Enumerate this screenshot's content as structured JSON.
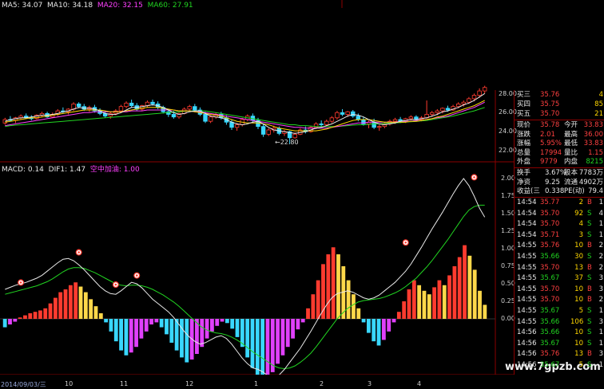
{
  "colors": {
    "ma5": "#e8e8e8",
    "ma10": "#ffd700",
    "ma20": "#ff40ff",
    "ma60": "#21d421",
    "bar_pos_red": "#ff3b2f",
    "bar_pos_yel": "#ffd84a",
    "bar_neg_mag": "#e040fb",
    "bar_neg_cyn": "#39d7ff",
    "border": "#8b0000"
  },
  "header": {
    "ma5": "MA5: 34.07",
    "ma10": "MA10: 34.18",
    "ma20": "MA20: 32.15",
    "ma60": "MA60: 27.91"
  },
  "price_axis": [
    "28.00",
    "26.00",
    "24.00",
    "22.00"
  ],
  "price_annotation": "←22.80",
  "macd_header": {
    "macd": "MACD: 0.14",
    "dif": "DIF1: 1.47",
    "signal": "空中加油: 1.00"
  },
  "macd_axis": [
    "2.00",
    "1.75",
    "1.50",
    "1.25",
    "1.00",
    "0.75",
    "0.50",
    "0.25",
    "0.00"
  ],
  "x_labels": [
    "2014/09/03/三",
    "10",
    "11",
    "12",
    "1",
    "2",
    "3",
    "4"
  ],
  "watermark": "www.7gpzb.com",
  "quotes": [
    {
      "label": "买三",
      "value": "35.76",
      "vol": "4"
    },
    {
      "label": "买四",
      "value": "35.75",
      "vol": "85"
    },
    {
      "label": "买五",
      "value": "35.70",
      "vol": "21"
    }
  ],
  "stats": [
    {
      "l1": "现价",
      "v1": "35.78",
      "l2": "今开",
      "v2": "33.83"
    },
    {
      "l1": "涨跌",
      "v1": "2.01",
      "l2": "最高",
      "v2": "36.00"
    },
    {
      "l1": "涨幅",
      "v1": "5.95%",
      "l2": "最低",
      "v2": "33.83"
    },
    {
      "l1": "总量",
      "v1": "17994",
      "l2": "量比",
      "v2": "1.15"
    },
    {
      "l1": "外盘",
      "v1": "9779",
      "l2": "内盘",
      "v2": "8215"
    }
  ],
  "info": [
    {
      "l1": "换手",
      "v1": "3.67%",
      "l2": "股本",
      "v2": "7783万"
    },
    {
      "l1": "净资",
      "v1": "9.25",
      "l2": "流通",
      "v2": "4902万"
    },
    {
      "l1": "收益(三",
      "v1": "0.338",
      "l2": "PE(动)",
      "v2": "79.4"
    }
  ],
  "ticks": [
    {
      "time": "14:54",
      "price": "35.77",
      "vol": "2",
      "bs": "B",
      "n": "1"
    },
    {
      "time": "14:54",
      "price": "35.70",
      "vol": "92",
      "bs": "S",
      "n": "4"
    },
    {
      "time": "14:54",
      "price": "35.70",
      "vol": "4",
      "bs": "S",
      "n": "1"
    },
    {
      "time": "14:54",
      "price": "35.71",
      "vol": "3",
      "bs": "S",
      "n": "1"
    },
    {
      "time": "14:55",
      "price": "35.76",
      "vol": "10",
      "bs": "B",
      "n": "2"
    },
    {
      "time": "14:55",
      "price": "35.66",
      "vol": "30",
      "bs": "S",
      "n": "2"
    },
    {
      "time": "14:55",
      "price": "35.70",
      "vol": "13",
      "bs": "B",
      "n": "2"
    },
    {
      "time": "14:55",
      "price": "35.67",
      "vol": "37",
      "bs": "S",
      "n": "3"
    },
    {
      "time": "14:55",
      "price": "35.70",
      "vol": "10",
      "bs": "B",
      "n": "3"
    },
    {
      "time": "14:55",
      "price": "35.70",
      "vol": "10",
      "bs": "B",
      "n": "2"
    },
    {
      "time": "14:55",
      "price": "35.67",
      "vol": "5",
      "bs": "S",
      "n": "1"
    },
    {
      "time": "14:55",
      "price": "35.66",
      "vol": "106",
      "bs": "S",
      "n": "3"
    },
    {
      "time": "14:56",
      "price": "35.66",
      "vol": "10",
      "bs": "S",
      "n": "1"
    },
    {
      "time": "14:56",
      "price": "35.67",
      "vol": "10",
      "bs": "S",
      "n": "1"
    },
    {
      "time": "14:56",
      "price": "35.76",
      "vol": "13",
      "bs": "B",
      "n": "3"
    },
    {
      "time": "14:56",
      "price": "35.67",
      "vol": "5",
      "bs": "S",
      "n": "1"
    }
  ],
  "chart_data": {
    "type": "candlestick+macd",
    "price_ylim": [
      21,
      29
    ],
    "macd_ylim": [
      -1.05,
      2.1
    ],
    "candles": [
      [
        25.2,
        25.8,
        25.0,
        25.6
      ],
      [
        25.6,
        26.0,
        25.4,
        25.5
      ],
      [
        25.5,
        25.9,
        25.2,
        25.8
      ],
      [
        25.8,
        26.2,
        25.6,
        26.0
      ],
      [
        26.0,
        26.3,
        25.7,
        25.8
      ],
      [
        25.8,
        26.1,
        25.5,
        25.7
      ],
      [
        25.7,
        26.2,
        25.6,
        26.1
      ],
      [
        26.1,
        26.5,
        25.9,
        26.3
      ],
      [
        26.3,
        26.5,
        25.8,
        25.9
      ],
      [
        25.9,
        26.4,
        25.8,
        26.2
      ],
      [
        26.2,
        26.8,
        26.0,
        26.6
      ],
      [
        26.6,
        27.0,
        26.3,
        26.5
      ],
      [
        26.5,
        26.9,
        26.2,
        26.8
      ],
      [
        26.8,
        27.6,
        26.6,
        27.4
      ],
      [
        27.4,
        27.6,
        26.9,
        27.1
      ],
      [
        27.1,
        27.4,
        26.6,
        26.8
      ],
      [
        26.8,
        27.2,
        26.5,
        27.0
      ],
      [
        27.0,
        27.3,
        26.4,
        26.6
      ],
      [
        26.6,
        26.9,
        26.1,
        26.3
      ],
      [
        26.3,
        26.6,
        25.8,
        26.0
      ],
      [
        26.0,
        26.5,
        25.7,
        26.3
      ],
      [
        26.3,
        26.8,
        26.1,
        26.6
      ],
      [
        26.6,
        27.3,
        26.4,
        27.1
      ],
      [
        27.1,
        27.7,
        26.9,
        27.5
      ],
      [
        27.5,
        27.9,
        27.0,
        27.2
      ],
      [
        27.2,
        27.5,
        26.6,
        26.8
      ],
      [
        26.8,
        27.3,
        26.6,
        27.2
      ],
      [
        27.2,
        27.8,
        27.0,
        27.6
      ],
      [
        27.6,
        27.9,
        27.2,
        27.4
      ],
      [
        27.4,
        27.7,
        26.8,
        27.0
      ],
      [
        27.0,
        27.2,
        26.3,
        26.5
      ],
      [
        26.5,
        26.8,
        25.9,
        26.2
      ],
      [
        26.2,
        26.6,
        25.7,
        25.9
      ],
      [
        25.9,
        26.4,
        25.7,
        26.3
      ],
      [
        26.3,
        27.0,
        26.2,
        26.8
      ],
      [
        26.8,
        27.3,
        26.6,
        27.1
      ],
      [
        27.1,
        27.4,
        26.5,
        26.7
      ],
      [
        26.7,
        27.0,
        26.0,
        26.2
      ],
      [
        26.2,
        26.5,
        25.2,
        25.4
      ],
      [
        25.4,
        26.1,
        25.2,
        25.9
      ],
      [
        25.9,
        26.4,
        25.7,
        26.2
      ],
      [
        26.2,
        26.5,
        25.6,
        25.8
      ],
      [
        25.8,
        26.1,
        25.0,
        25.3
      ],
      [
        25.3,
        25.6,
        24.4,
        24.7
      ],
      [
        24.7,
        25.2,
        24.3,
        25.0
      ],
      [
        25.0,
        25.8,
        24.8,
        25.6
      ],
      [
        25.6,
        26.2,
        25.4,
        26.0
      ],
      [
        26.0,
        26.3,
        25.2,
        25.5
      ],
      [
        25.5,
        25.8,
        24.5,
        24.8
      ],
      [
        24.8,
        25.1,
        23.6,
        23.9
      ],
      [
        23.9,
        24.6,
        23.7,
        24.4
      ],
      [
        24.4,
        24.9,
        24.1,
        24.6
      ],
      [
        24.6,
        24.8,
        23.8,
        24.0
      ],
      [
        24.0,
        24.4,
        23.7,
        24.2
      ],
      [
        24.2,
        24.3,
        22.8,
        23.5
      ],
      [
        23.5,
        24.1,
        23.4,
        23.9
      ],
      [
        23.9,
        24.6,
        23.8,
        24.4
      ],
      [
        24.4,
        24.8,
        24.0,
        24.2
      ],
      [
        24.2,
        24.9,
        24.1,
        24.7
      ],
      [
        24.7,
        25.3,
        24.5,
        25.1
      ],
      [
        25.1,
        25.5,
        24.8,
        25.0
      ],
      [
        25.0,
        25.6,
        24.9,
        25.4
      ],
      [
        25.4,
        26.0,
        25.2,
        25.8
      ],
      [
        25.8,
        26.6,
        25.6,
        26.4
      ],
      [
        26.4,
        26.8,
        26.0,
        26.2
      ],
      [
        26.2,
        26.6,
        25.9,
        26.5
      ],
      [
        26.5,
        26.7,
        25.8,
        26.0
      ],
      [
        26.0,
        26.3,
        25.4,
        25.6
      ],
      [
        25.6,
        25.9,
        24.9,
        25.1
      ],
      [
        25.1,
        25.5,
        24.6,
        25.3
      ],
      [
        25.3,
        25.7,
        24.5,
        24.7
      ],
      [
        24.7,
        25.0,
        24.3,
        24.8
      ],
      [
        24.8,
        25.3,
        24.6,
        25.1
      ],
      [
        25.1,
        25.6,
        24.9,
        25.4
      ],
      [
        25.4,
        25.8,
        25.1,
        25.6
      ],
      [
        25.6,
        25.9,
        25.2,
        25.4
      ],
      [
        25.4,
        25.8,
        25.2,
        25.7
      ],
      [
        25.7,
        26.1,
        25.5,
        25.9
      ],
      [
        25.9,
        26.1,
        25.4,
        25.6
      ],
      [
        25.6,
        26.0,
        25.4,
        25.8
      ],
      [
        25.8,
        27.8,
        25.7,
        26.2
      ],
      [
        26.2,
        26.6,
        25.9,
        26.4
      ],
      [
        26.4,
        26.8,
        26.1,
        26.6
      ],
      [
        26.6,
        27.0,
        26.3,
        26.9
      ],
      [
        26.9,
        27.2,
        26.5,
        26.7
      ],
      [
        26.7,
        27.3,
        26.6,
        27.1
      ],
      [
        27.1,
        27.6,
        26.9,
        27.4
      ],
      [
        27.4,
        27.8,
        27.1,
        27.6
      ],
      [
        27.6,
        28.2,
        27.4,
        28.0
      ],
      [
        28.0,
        28.6,
        27.7,
        28.4
      ],
      [
        28.4,
        29.2,
        28.1,
        28.9
      ],
      [
        28.9,
        29.5,
        28.6,
        29.3
      ]
    ],
    "ma5": [
      25.4,
      25.6,
      25.7,
      25.8,
      25.8,
      25.9,
      26.0,
      26.1,
      26.1,
      26.2,
      26.3,
      26.5,
      26.6,
      26.8,
      27.0,
      26.9,
      26.9,
      26.8,
      26.6,
      26.3,
      26.2,
      26.2,
      26.4,
      26.7,
      27.0,
      27.0,
      27.1,
      27.2,
      27.3,
      27.2,
      27.0,
      26.7,
      26.4,
      26.2,
      26.3,
      26.5,
      26.6,
      26.6,
      26.3,
      26.0,
      25.9,
      25.8,
      25.6,
      25.3,
      25.1,
      25.0,
      25.1,
      25.3,
      25.4,
      25.1,
      24.7,
      24.4,
      24.3,
      24.2,
      24.1,
      24.0,
      24.1,
      24.2,
      24.4,
      24.6,
      24.7,
      24.9,
      25.1,
      25.4,
      25.7,
      26.0,
      26.2,
      26.1,
      25.9,
      25.6,
      25.3,
      25.1,
      25.0,
      25.1,
      25.2,
      25.4,
      25.5,
      25.6,
      25.6,
      25.7,
      25.8,
      26.0,
      26.2,
      26.5,
      26.6,
      26.8,
      27.0,
      27.3,
      27.5,
      27.8,
      28.2,
      28.6
    ],
    "ma10": [
      25.3,
      25.4,
      25.5,
      25.6,
      25.7,
      25.8,
      25.8,
      25.9,
      26.0,
      26.1,
      26.2,
      26.3,
      26.4,
      26.5,
      26.6,
      26.7,
      26.7,
      26.7,
      26.7,
      26.6,
      26.5,
      26.5,
      26.5,
      26.6,
      26.7,
      26.8,
      26.9,
      27.0,
      27.0,
      27.0,
      26.9,
      26.8,
      26.7,
      26.6,
      26.6,
      26.6,
      26.5,
      26.4,
      26.3,
      26.2,
      26.1,
      26.0,
      25.8,
      25.6,
      25.4,
      25.3,
      25.2,
      25.2,
      25.2,
      25.1,
      25.0,
      24.8,
      24.6,
      24.5,
      24.4,
      24.3,
      24.3,
      24.3,
      24.3,
      24.3,
      24.4,
      24.5,
      24.7,
      24.9,
      25.1,
      25.3,
      25.5,
      25.6,
      25.6,
      25.6,
      25.5,
      25.4,
      25.3,
      25.3,
      25.3,
      25.3,
      25.3,
      25.4,
      25.4,
      25.5,
      25.6,
      25.7,
      25.9,
      26.0,
      26.2,
      26.4,
      26.6,
      26.8,
      27.0,
      27.2,
      27.5,
      27.8
    ],
    "ma20": [
      24.9,
      25.0,
      25.1,
      25.2,
      25.3,
      25.4,
      25.5,
      25.6,
      25.7,
      25.8,
      25.9,
      26.0,
      26.1,
      26.2,
      26.3,
      26.4,
      26.4,
      26.5,
      26.5,
      26.5,
      26.5,
      26.5,
      26.5,
      26.5,
      26.6,
      26.6,
      26.6,
      26.7,
      26.7,
      26.7,
      26.7,
      26.7,
      26.7,
      26.6,
      26.6,
      26.6,
      26.5,
      26.5,
      26.4,
      26.3,
      26.2,
      26.1,
      26.0,
      25.9,
      25.8,
      25.7,
      25.6,
      25.5,
      25.4,
      25.3,
      25.2,
      25.1,
      25.0,
      24.9,
      24.8,
      24.7,
      24.7,
      24.6,
      24.6,
      24.6,
      24.6,
      24.6,
      24.7,
      24.8,
      24.9,
      25.0,
      25.1,
      25.2,
      25.2,
      25.3,
      25.3,
      25.3,
      25.3,
      25.3,
      25.3,
      25.4,
      25.4,
      25.4,
      25.5,
      25.5,
      25.6,
      25.7,
      25.8,
      25.9,
      26.0,
      26.2,
      26.4,
      26.6,
      26.8,
      27.0,
      27.3,
      27.6
    ],
    "ma60": [
      24.8,
      24.9,
      24.95,
      25.0,
      25.05,
      25.1,
      25.15,
      25.2,
      25.25,
      25.3,
      25.35,
      25.4,
      25.45,
      25.5,
      25.55,
      25.6,
      25.65,
      25.7,
      25.75,
      25.8,
      25.85,
      25.9,
      25.95,
      26.0,
      26.05,
      26.1,
      26.15,
      26.2,
      26.25,
      26.3,
      26.35,
      26.4,
      26.45,
      26.5,
      26.55,
      26.6,
      26.6,
      26.6,
      26.6,
      26.5,
      26.4,
      26.3,
      26.2,
      26.1,
      26.0,
      25.9,
      25.8,
      25.7,
      25.6,
      25.5,
      25.4,
      25.3,
      25.2,
      25.1,
      25.0,
      25.0,
      24.9,
      24.9,
      24.85,
      24.8,
      24.8,
      24.8,
      24.8,
      24.8,
      24.85,
      24.9,
      24.95,
      25.0,
      25.0,
      25.05,
      25.1,
      25.1,
      25.15,
      25.2,
      25.2,
      25.25,
      25.3,
      25.35,
      25.4,
      25.45,
      25.5,
      25.6,
      25.7,
      25.8,
      25.9,
      26.0,
      26.15,
      26.3,
      26.45,
      26.6,
      26.8,
      27.0
    ],
    "macd_bars": [
      -0.12,
      -0.08,
      -0.04,
      0.02,
      0.05,
      0.08,
      0.1,
      0.12,
      0.15,
      0.22,
      0.3,
      0.38,
      0.42,
      0.48,
      0.52,
      0.46,
      0.38,
      0.28,
      0.18,
      0.08,
      -0.05,
      -0.18,
      -0.32,
      -0.45,
      -0.52,
      -0.48,
      -0.4,
      -0.28,
      -0.18,
      -0.08,
      -0.05,
      -0.12,
      -0.22,
      -0.34,
      -0.45,
      -0.55,
      -0.62,
      -0.58,
      -0.5,
      -0.4,
      -0.28,
      -0.18,
      -0.1,
      -0.04,
      -0.06,
      -0.14,
      -0.26,
      -0.4,
      -0.55,
      -0.7,
      -0.85,
      -0.95,
      -0.88,
      -0.76,
      -0.64,
      -0.52,
      -0.4,
      -0.28,
      -0.15,
      -0.05,
      0.15,
      0.35,
      0.55,
      0.78,
      0.92,
      1.02,
      0.92,
      0.75,
      0.55,
      0.35,
      0.15,
      -0.05,
      -0.2,
      -0.32,
      -0.38,
      -0.3,
      -0.18,
      -0.05,
      0.1,
      0.25,
      0.42,
      0.55,
      0.48,
      0.4,
      0.35,
      0.45,
      0.55,
      0.48,
      0.62,
      0.75,
      0.88,
      1.05,
      0.9,
      0.7,
      0.4,
      0.2
    ],
    "dif": [
      0.42,
      0.45,
      0.48,
      0.5,
      0.52,
      0.55,
      0.58,
      0.62,
      0.68,
      0.74,
      0.8,
      0.85,
      0.86,
      0.83,
      0.77,
      0.7,
      0.62,
      0.54,
      0.46,
      0.4,
      0.36,
      0.35,
      0.4,
      0.46,
      0.52,
      0.5,
      0.44,
      0.36,
      0.28,
      0.22,
      0.16,
      0.1,
      0.02,
      -0.08,
      -0.18,
      -0.26,
      -0.32,
      -0.36,
      -0.34,
      -0.3,
      -0.26,
      -0.24,
      -0.28,
      -0.36,
      -0.46,
      -0.56,
      -0.64,
      -0.7,
      -0.72,
      -0.76,
      -0.82,
      -0.86,
      -0.8,
      -0.72,
      -0.62,
      -0.52,
      -0.42,
      -0.3,
      -0.18,
      -0.05,
      0.08,
      0.2,
      0.3,
      0.36,
      0.38,
      0.4,
      0.38,
      0.34,
      0.3,
      0.28,
      0.3,
      0.34,
      0.4,
      0.46,
      0.52,
      0.6,
      0.68,
      0.78,
      0.9,
      1.02,
      1.15,
      1.28,
      1.4,
      1.52,
      1.65,
      1.78,
      1.9,
      2.0,
      1.9,
      1.75,
      1.58,
      1.45
    ],
    "dea": [
      0.35,
      0.37,
      0.39,
      0.41,
      0.43,
      0.45,
      0.47,
      0.5,
      0.53,
      0.57,
      0.62,
      0.67,
      0.71,
      0.73,
      0.73,
      0.72,
      0.69,
      0.66,
      0.62,
      0.58,
      0.54,
      0.5,
      0.48,
      0.47,
      0.48,
      0.48,
      0.47,
      0.45,
      0.42,
      0.38,
      0.34,
      0.29,
      0.24,
      0.18,
      0.11,
      0.04,
      -0.03,
      -0.1,
      -0.15,
      -0.18,
      -0.2,
      -0.21,
      -0.23,
      -0.26,
      -0.3,
      -0.35,
      -0.41,
      -0.47,
      -0.52,
      -0.57,
      -0.62,
      -0.67,
      -0.7,
      -0.71,
      -0.7,
      -0.67,
      -0.62,
      -0.56,
      -0.49,
      -0.4,
      -0.3,
      -0.2,
      -0.1,
      0.0,
      0.08,
      0.15,
      0.2,
      0.24,
      0.26,
      0.27,
      0.28,
      0.29,
      0.31,
      0.34,
      0.37,
      0.41,
      0.46,
      0.52,
      0.58,
      0.66,
      0.74,
      0.83,
      0.93,
      1.03,
      1.13,
      1.24,
      1.35,
      1.46,
      1.55,
      1.6,
      1.62,
      1.62
    ],
    "markers": [
      {
        "i": 3,
        "v": 0.45
      },
      {
        "i": 14,
        "v": 0.88
      },
      {
        "i": 21,
        "v": 0.42
      },
      {
        "i": 25,
        "v": 0.55
      },
      {
        "i": 76,
        "v": 1.02
      },
      {
        "i": 89,
        "v": 1.95
      }
    ]
  }
}
